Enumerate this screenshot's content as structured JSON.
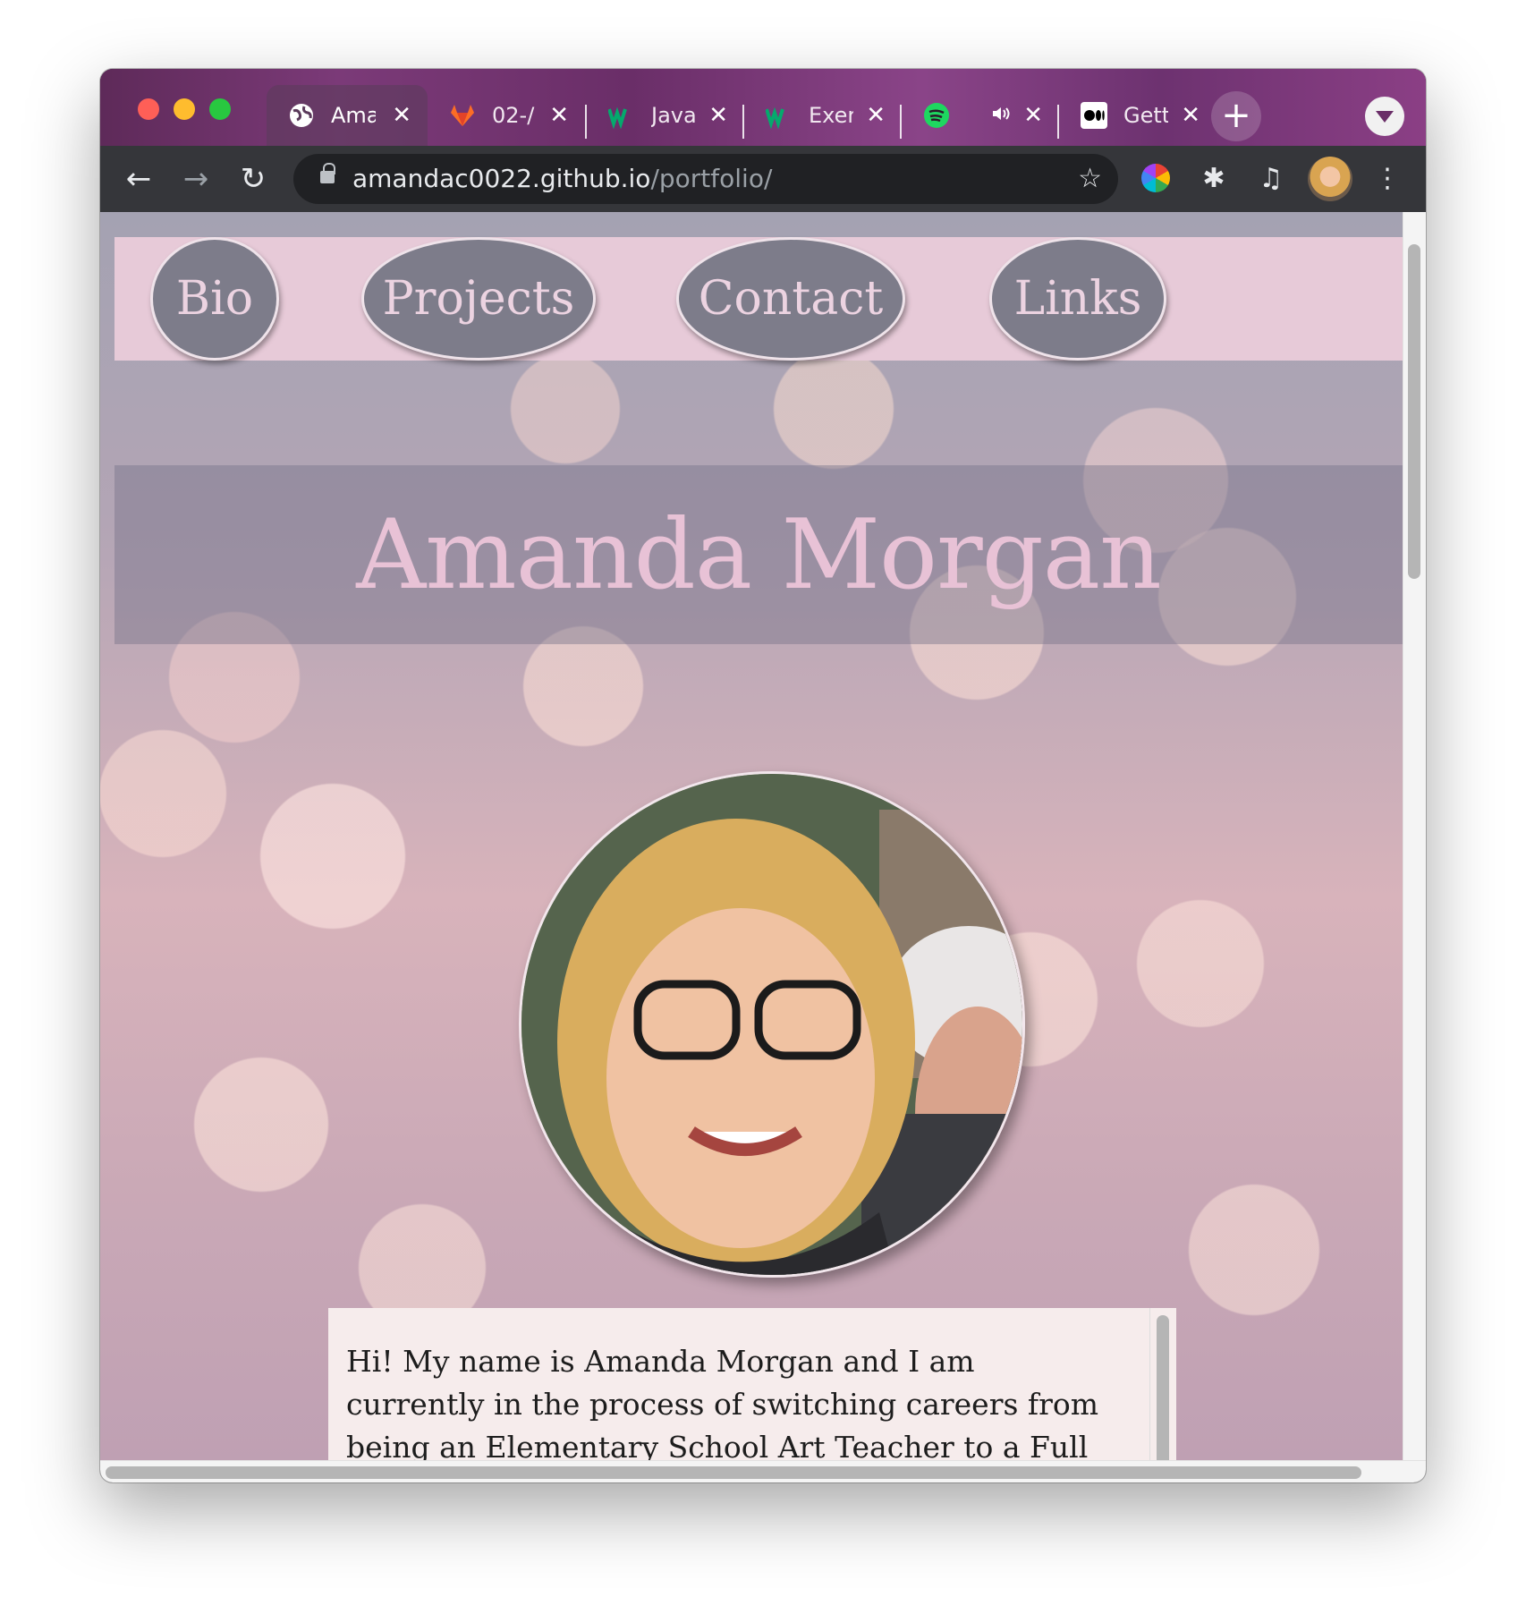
{
  "browser": {
    "tabs": [
      {
        "title": "Ama",
        "icon": "globe-icon",
        "active": true
      },
      {
        "title": "02-/",
        "icon": "gitlab-icon",
        "active": false
      },
      {
        "title": "Java",
        "icon": "w3schools-icon",
        "active": false
      },
      {
        "title": "Exer",
        "icon": "w3schools-icon",
        "active": false
      },
      {
        "title": "",
        "icon": "spotify-icon",
        "active": false
      },
      {
        "title": "Gett",
        "icon": "medium-icon",
        "active": false
      }
    ],
    "close_glyph": "✕",
    "newtab_glyph": "+",
    "url_host": "amandac0022.github.io",
    "url_path": "/portfolio/",
    "back_glyph": "←",
    "forward_glyph": "→",
    "reload_glyph": "↻",
    "star_glyph": "☆",
    "menu_glyph": "⋮",
    "puzzle_glyph": "✱",
    "media_glyph": "♫"
  },
  "site": {
    "nav": [
      "Bio",
      "Projects",
      "Contact",
      "Links"
    ],
    "name": "Amanda Morgan",
    "bio_text": "Hi! My name is Amanda Morgan and I am currently in the process of switching careers from being an Elementary School Art Teacher to a Full Stack Website"
  },
  "colors": {
    "tab_strip": "#7b3a78",
    "nav_bar": "#e7cad8",
    "nav_pill": "#7d7c8a",
    "name_text": "#e8c2d6"
  }
}
